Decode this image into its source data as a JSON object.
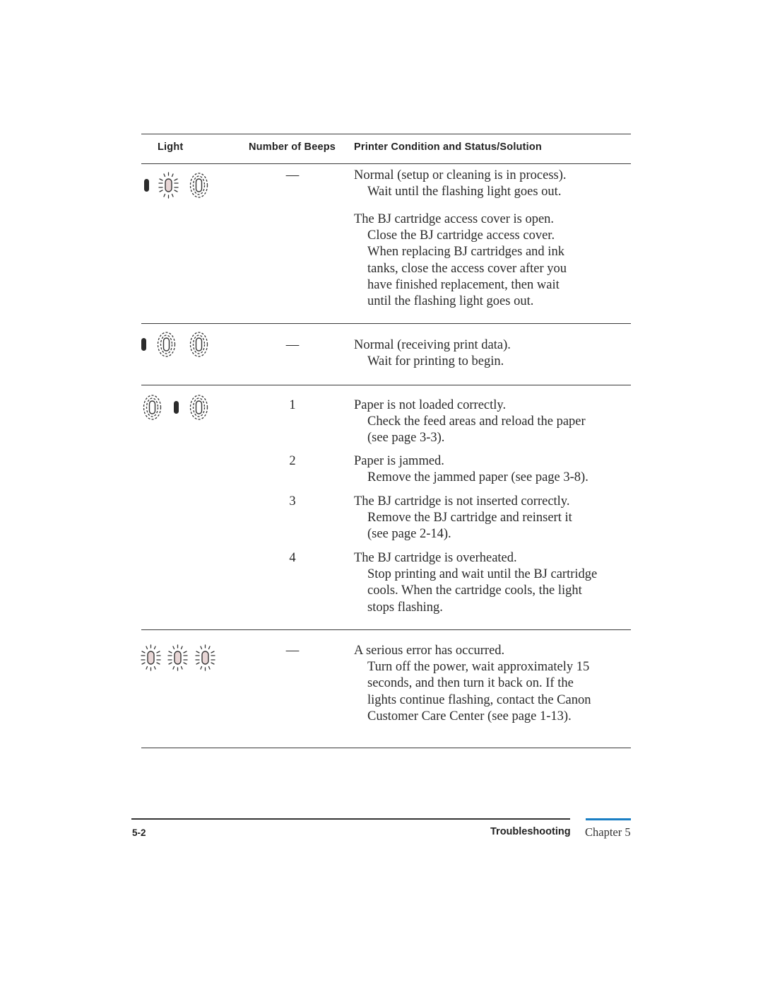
{
  "table": {
    "headers": {
      "light": "Light",
      "beeps": "Number of Beeps",
      "condition": "Printer Condition and Status/Solution"
    },
    "rows": [
      {
        "lights": [
          "on",
          "flashing",
          "off"
        ],
        "entries": [
          {
            "beeps": "—",
            "condition": "Normal (setup or cleaning is in process).",
            "solution": [
              "Wait until the flashing light goes out."
            ]
          },
          {
            "beeps": "",
            "condition": "The BJ cartridge access cover is open.",
            "solution": [
              "Close the BJ cartridge access cover.",
              "When replacing BJ cartridges and ink",
              "tanks, close the access cover after you",
              "have finished replacement, then wait",
              "until the flashing light goes out."
            ]
          }
        ]
      },
      {
        "lights": [
          "on",
          "off",
          "off"
        ],
        "entries": [
          {
            "beeps": "—",
            "condition": "Normal (receiving print data).",
            "solution": [
              "Wait for printing to begin."
            ]
          }
        ]
      },
      {
        "lights": [
          "off",
          "on",
          "off"
        ],
        "entries": [
          {
            "beeps": "1",
            "condition": "Paper is not loaded correctly.",
            "solution": [
              "Check the feed areas and reload the paper",
              "(see page 3-3)."
            ]
          },
          {
            "beeps": "2",
            "condition": "Paper is jammed.",
            "solution": [
              "Remove the jammed paper (see page 3-8)."
            ]
          },
          {
            "beeps": "3",
            "condition": "The BJ cartridge is not inserted correctly.",
            "solution": [
              "Remove the BJ cartridge and reinsert it",
              "(see page 2-14)."
            ]
          },
          {
            "beeps": "4",
            "condition": "The BJ cartridge is overheated.",
            "solution": [
              "Stop printing and wait until the BJ cartridge",
              "cools. When the cartridge cools, the light",
              "stops flashing."
            ]
          }
        ]
      },
      {
        "lights": [
          "flashing",
          "flashing",
          "flashing"
        ],
        "entries": [
          {
            "beeps": "—",
            "condition": "A serious error has occurred.",
            "solution": [
              "Turn off the power, wait approximately 15",
              "seconds, and then turn it back on. If the",
              "lights continue flashing, contact the Canon",
              "Customer Care Center (see page 1-13)."
            ]
          }
        ]
      }
    ]
  },
  "footer": {
    "page_number": "5-2",
    "section": "Troubleshooting",
    "chapter": "Chapter 5"
  },
  "colors": {
    "accent": "#1a7fc4",
    "lamp_on": "#2b2b2b",
    "lamp_flash_fill": "#e8d6d6"
  }
}
